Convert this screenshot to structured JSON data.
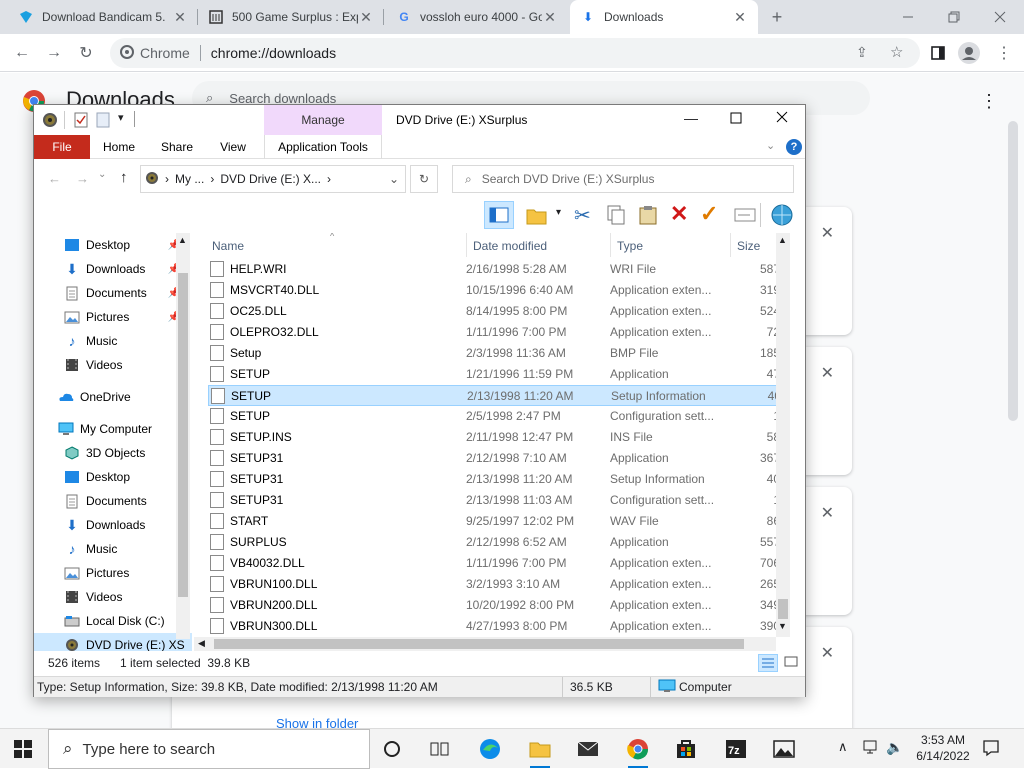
{
  "browser": {
    "tabs": [
      {
        "title": "Download Bandicam 5.",
        "favicon": "bandicam-icon"
      },
      {
        "title": "500 Game Surplus : Exp",
        "favicon": "archive-icon"
      },
      {
        "title": "vossloh euro 4000 - Go",
        "favicon": "google-icon"
      },
      {
        "title": "Downloads",
        "favicon": "download-icon"
      }
    ],
    "new_tab": "+",
    "omnibox": {
      "site": "Chrome",
      "url": "chrome://downloads"
    }
  },
  "downloads_page": {
    "title": "Downloads",
    "search_placeholder": "Search downloads",
    "show_in_folder": "Show in folder"
  },
  "explorer": {
    "title": "DVD Drive (E:) XSurplus",
    "manage_label": "Manage",
    "ribbon_tabs": [
      "File",
      "Home",
      "Share",
      "View",
      "Application Tools"
    ],
    "breadcrumb": [
      "My ...",
      "DVD Drive (E:) X..."
    ],
    "search_placeholder": "Search DVD Drive (E:) XSurplus",
    "nav_items": [
      {
        "label": "Desktop",
        "icon": "desktop-icon",
        "pinned": true
      },
      {
        "label": "Downloads",
        "icon": "downloads-icon",
        "pinned": true
      },
      {
        "label": "Documents",
        "icon": "documents-icon",
        "pinned": true
      },
      {
        "label": "Pictures",
        "icon": "pictures-icon",
        "pinned": true
      },
      {
        "label": "Music",
        "icon": "music-icon",
        "pinned": false
      },
      {
        "label": "Videos",
        "icon": "videos-icon",
        "pinned": false
      },
      {
        "label": "OneDrive",
        "icon": "onedrive-icon",
        "pinned": false
      },
      {
        "label": "My Computer",
        "icon": "computer-icon",
        "pinned": false
      },
      {
        "label": "3D Objects",
        "icon": "3d-objects-icon",
        "pinned": false
      },
      {
        "label": "Desktop",
        "icon": "desktop-icon",
        "pinned": false
      },
      {
        "label": "Documents",
        "icon": "documents-icon",
        "pinned": false
      },
      {
        "label": "Downloads",
        "icon": "downloads-icon",
        "pinned": false
      },
      {
        "label": "Music",
        "icon": "music-icon",
        "pinned": false
      },
      {
        "label": "Pictures",
        "icon": "pictures-icon",
        "pinned": false
      },
      {
        "label": "Videos",
        "icon": "videos-icon",
        "pinned": false
      },
      {
        "label": "Local Disk (C:)",
        "icon": "local-disk-icon",
        "pinned": false
      },
      {
        "label": "DVD Drive (E:) XS",
        "icon": "dvd-drive-icon",
        "pinned": false
      }
    ],
    "columns": {
      "name": "Name",
      "date": "Date modified",
      "type": "Type",
      "size": "Size"
    },
    "files": [
      {
        "name": "HELP.WRI",
        "date": "2/16/1998 5:28 AM",
        "type": "WRI File",
        "size": "587"
      },
      {
        "name": "MSVCRT40.DLL",
        "date": "10/15/1996 6:40 AM",
        "type": "Application exten...",
        "size": "319"
      },
      {
        "name": "OC25.DLL",
        "date": "8/14/1995 8:00 PM",
        "type": "Application exten...",
        "size": "524"
      },
      {
        "name": "OLEPRO32.DLL",
        "date": "1/11/1996 7:00 PM",
        "type": "Application exten...",
        "size": "72"
      },
      {
        "name": "Setup",
        "date": "2/3/1998 11:36 AM",
        "type": "BMP File",
        "size": "185"
      },
      {
        "name": "SETUP",
        "date": "1/21/1996 11:59 PM",
        "type": "Application",
        "size": "47"
      },
      {
        "name": "SETUP",
        "date": "2/13/1998 11:20 AM",
        "type": "Setup Information",
        "size": "40"
      },
      {
        "name": "SETUP",
        "date": "2/5/1998 2:47 PM",
        "type": "Configuration sett...",
        "size": "1"
      },
      {
        "name": "SETUP.INS",
        "date": "2/11/1998 12:47 PM",
        "type": "INS File",
        "size": "58"
      },
      {
        "name": "SETUP31",
        "date": "2/12/1998 7:10 AM",
        "type": "Application",
        "size": "367"
      },
      {
        "name": "SETUP31",
        "date": "2/13/1998 11:20 AM",
        "type": "Setup Information",
        "size": "40"
      },
      {
        "name": "SETUP31",
        "date": "2/13/1998 11:03 AM",
        "type": "Configuration sett...",
        "size": "1"
      },
      {
        "name": "START",
        "date": "9/25/1997 12:02 PM",
        "type": "WAV File",
        "size": "86"
      },
      {
        "name": "SURPLUS",
        "date": "2/12/1998 6:52 AM",
        "type": "Application",
        "size": "557"
      },
      {
        "name": "VB40032.DLL",
        "date": "1/11/1996 7:00 PM",
        "type": "Application exten...",
        "size": "706"
      },
      {
        "name": "VBRUN100.DLL",
        "date": "3/2/1993 3:10 AM",
        "type": "Application exten...",
        "size": "265"
      },
      {
        "name": "VBRUN200.DLL",
        "date": "10/20/1992 8:00 PM",
        "type": "Application exten...",
        "size": "349"
      },
      {
        "name": "VBRUN300.DLL",
        "date": "4/27/1993 8:00 PM",
        "type": "Application exten...",
        "size": "390"
      }
    ],
    "status": {
      "items": "526 items",
      "selected": "1 item selected  39.8 KB"
    },
    "details": {
      "info": "Type: Setup Information, Size: 39.8 KB, Date modified: 2/13/1998 11:20 AM",
      "size": "36.5 KB",
      "location": "Computer"
    }
  },
  "taskbar": {
    "search_placeholder": "Type here to search",
    "time": "3:53 AM",
    "date": "6/14/2022"
  },
  "colors": {
    "accent": "#0078d4",
    "file_tab": "#c42b1c",
    "selection": "#cce8ff",
    "manage_tab": "#e8c8f8"
  }
}
